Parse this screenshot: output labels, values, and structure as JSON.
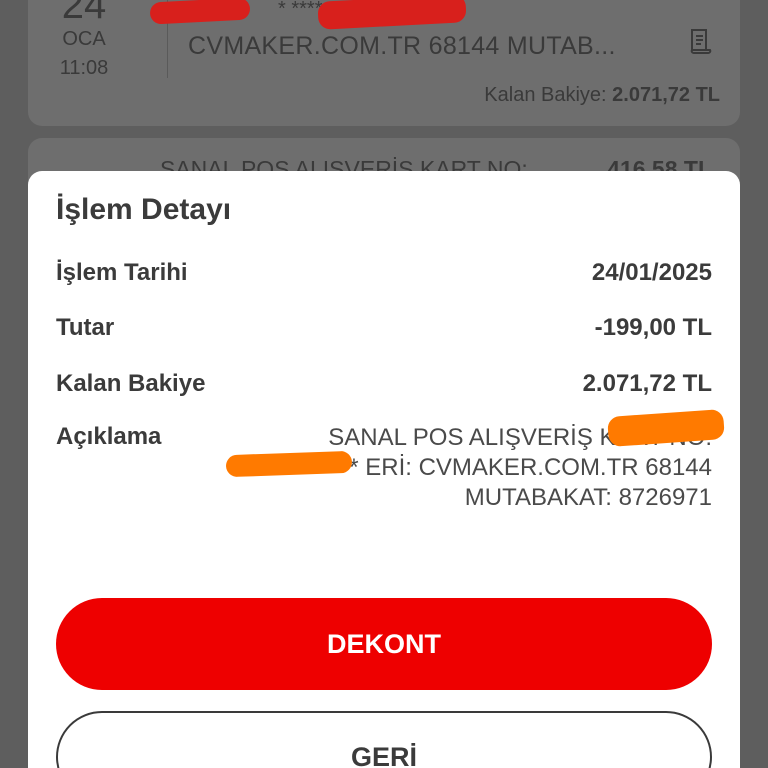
{
  "background_list": {
    "date_day": "24",
    "date_month": "OCA",
    "date_time": "11:08",
    "masked_line": "* ****",
    "merchant_line": "CVMAKER.COM.TR 68144 MUTAB...",
    "balance_label": "Kalan Bakiye:",
    "balance_value": "2.071,72 TL",
    "next_line": "SANAL POS ALIŞVERİŞ KART NO:",
    "next_amount": "416,58 TL"
  },
  "modal": {
    "title": "İşlem Detayı",
    "rows": [
      {
        "label": "İşlem Tarihi",
        "value": "24/01/2025"
      },
      {
        "label": "Tutar",
        "value": "-199,00 TL"
      },
      {
        "label": "Kalan Bakiye",
        "value": "2.071,72 TL"
      }
    ],
    "description_label": "Açıklama",
    "description_lines": [
      "SANAL POS ALIŞVERİŞ KART NO:",
      "**          ERİ: CVMAKER.COM.TR 68144",
      "MUTABAKAT: 8726971"
    ],
    "primary_button": "DEKONT",
    "secondary_button": "GERİ"
  },
  "colors": {
    "accent": "#ee0000",
    "redaction_red": "#d8201c",
    "redaction_orange": "#ff7a00"
  }
}
